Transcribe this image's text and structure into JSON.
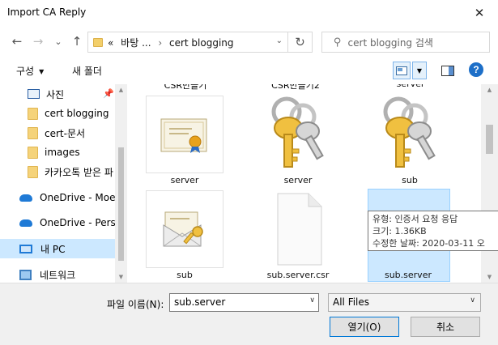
{
  "window": {
    "title": "Import CA Reply",
    "close_glyph": "✕"
  },
  "nav": {
    "breadcrumb_prefix": "«",
    "breadcrumb": [
      "바탕 ...",
      "cert blogging"
    ],
    "breadcrumb_sep": "›",
    "search_placeholder": "cert blogging 검색",
    "back_glyph": "←",
    "forward_glyph": "→",
    "down_glyph": "⌄",
    "up_glyph": "↑",
    "refresh_glyph": "↻",
    "search_glyph": "⚲"
  },
  "toolbar": {
    "organize_label": "구성",
    "new_folder_label": "새 폴더",
    "help_glyph": "?",
    "caret_glyph": "▼"
  },
  "sidebar": {
    "items": [
      {
        "label": "사진",
        "icon": "pictures-icon"
      },
      {
        "label": "cert blogging",
        "icon": "folder-icon"
      },
      {
        "label": "cert-문서",
        "icon": "folder-icon"
      },
      {
        "label": "images",
        "icon": "folder-icon"
      },
      {
        "label": "카카오톡 받은 파",
        "icon": "folder-icon"
      },
      {
        "label": "OneDrive - Moe,",
        "icon": "onedrive-icon"
      },
      {
        "label": "OneDrive - Person",
        "icon": "onedrive-icon"
      },
      {
        "label": "내 PC",
        "icon": "pc-icon"
      },
      {
        "label": "네트워크",
        "icon": "network-icon"
      }
    ],
    "pin_glyph": "📌"
  },
  "files": {
    "cut_off_labels": [
      "CSR만들기",
      "CSR만들기2",
      "server"
    ],
    "items": [
      {
        "name": "server",
        "type": "certificate"
      },
      {
        "name": "server",
        "type": "keys"
      },
      {
        "name": "sub",
        "type": "keys"
      },
      {
        "name": "sub",
        "type": "cert-mail"
      },
      {
        "name": "sub.server.csr",
        "type": "blank-file"
      },
      {
        "name": "sub.server",
        "type": "selected-file"
      }
    ]
  },
  "tooltip": {
    "lines": [
      "유형: 인증서 요청 응답",
      "크기: 1.36KB",
      "수정한 날짜: 2020-03-11 오"
    ]
  },
  "bottom": {
    "filename_label": "파일 이름(N):",
    "filename_value": "sub.server",
    "filetype_value": "All Files",
    "open_label": "열기(O)",
    "cancel_label": "취소",
    "dropdown_glyph": "∨"
  },
  "colors": {
    "selection": "#cce8ff",
    "accent": "#0078d7",
    "folder": "#f5d37a"
  }
}
